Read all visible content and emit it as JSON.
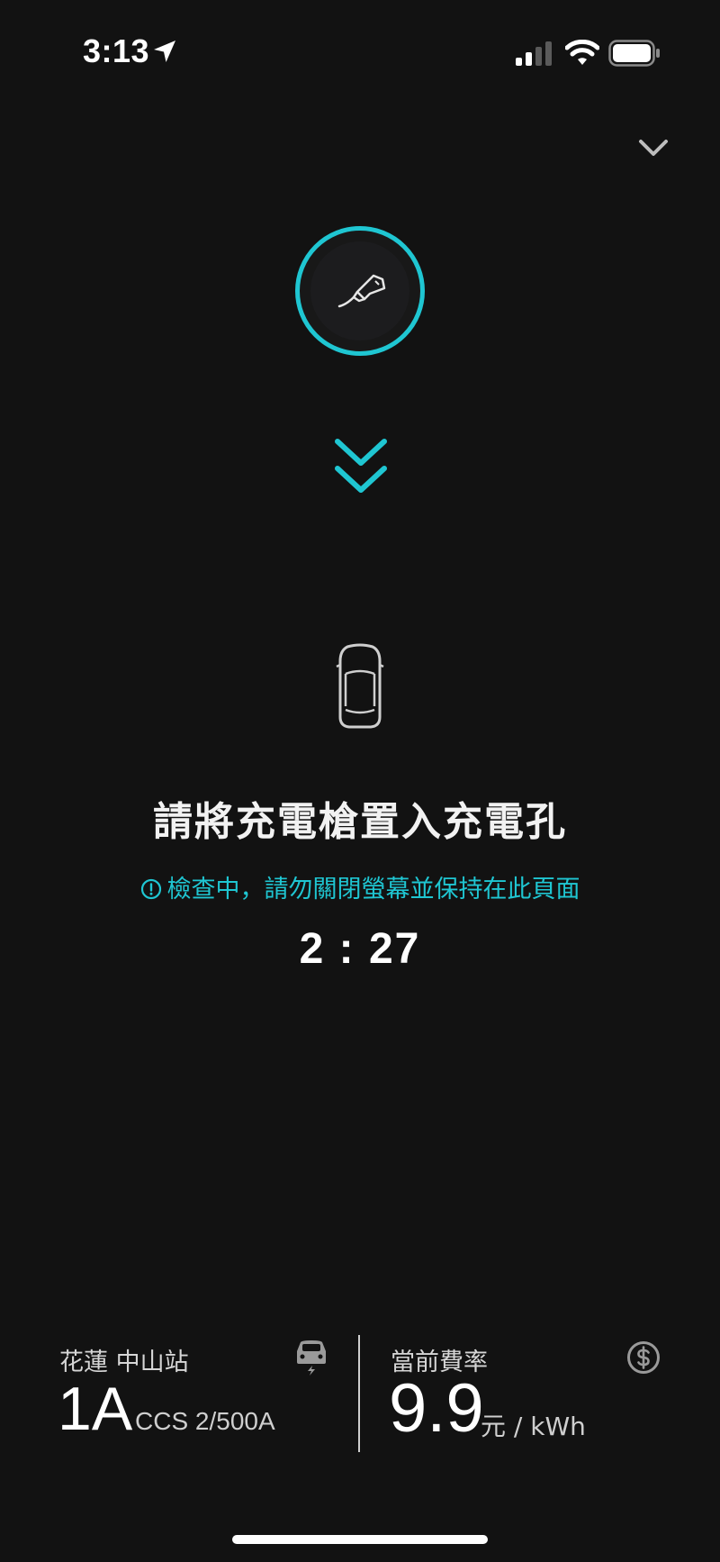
{
  "status_bar": {
    "time": "3:13"
  },
  "main": {
    "instruction_title": "請將充電槍置入充電孔",
    "hint": "檢查中，請勿關閉螢幕並保持在此頁面",
    "countdown": "2 : 27"
  },
  "info": {
    "station_name": "花蓮 中山站",
    "connector_number": "1A",
    "connector_spec": "CCS 2/500A",
    "rate_label": "當前費率",
    "rate_value": "9.9",
    "rate_unit": "元 / kWh"
  },
  "colors": {
    "background": "#121212",
    "accent": "#1fc6d2",
    "text_primary": "#ffffff",
    "text_secondary": "#d6d6d6"
  },
  "icons": {
    "location": "location-arrow-icon",
    "signal": "cellular-signal-icon",
    "wifi": "wifi-icon",
    "battery": "battery-icon",
    "collapse": "chevron-down-icon",
    "plug": "charging-plug-icon",
    "arrows": "double-chevron-down-icon",
    "car": "car-top-view-icon",
    "alert": "alert-circle-icon",
    "station": "ev-charger-station-icon",
    "dollar": "dollar-circle-icon"
  }
}
